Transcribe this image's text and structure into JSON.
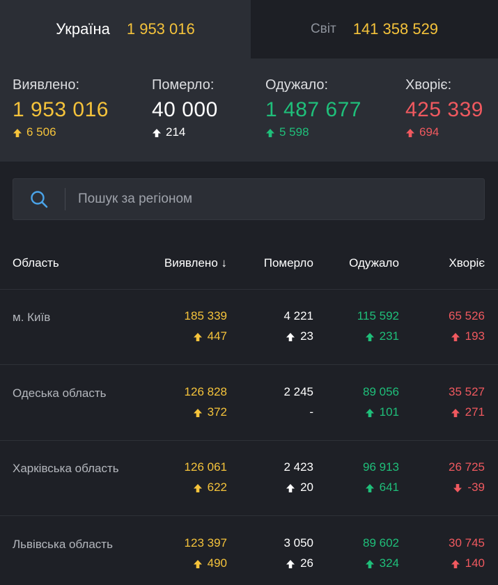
{
  "tabs": {
    "ukraine": {
      "label": "Україна",
      "value": "1 953 016"
    },
    "world": {
      "label": "Світ",
      "value": "141 358 529"
    }
  },
  "summary": {
    "detected": {
      "label": "Виявлено:",
      "value": "1 953 016",
      "delta": "6 506"
    },
    "died": {
      "label": "Померло:",
      "value": "40 000",
      "delta": "214"
    },
    "recovered": {
      "label": "Одужало:",
      "value": "1 487 677",
      "delta": "5 598"
    },
    "sick": {
      "label": "Хворіє:",
      "value": "425 339",
      "delta": "694"
    }
  },
  "search": {
    "placeholder": "Пошук за регіоном"
  },
  "table": {
    "headers": {
      "region": "Область",
      "detected": "Виявлено ↓",
      "died": "Померло",
      "recovered": "Одужало",
      "sick": "Хворіє"
    },
    "rows": [
      {
        "region": "м. Київ",
        "detected": "185 339",
        "detected_delta": "447",
        "died": "4 221",
        "died_delta": "23",
        "recovered": "115 592",
        "recovered_delta": "231",
        "sick": "65 526",
        "sick_delta": "193"
      },
      {
        "region": "Одеська область",
        "detected": "126 828",
        "detected_delta": "372",
        "died": "2 245",
        "died_delta": "-",
        "recovered": "89 056",
        "recovered_delta": "101",
        "sick": "35 527",
        "sick_delta": "271"
      },
      {
        "region": "Харківська область",
        "detected": "126 061",
        "detected_delta": "622",
        "died": "2 423",
        "died_delta": "20",
        "recovered": "96 913",
        "recovered_delta": "641",
        "sick": "26 725",
        "sick_delta": "-39"
      },
      {
        "region": "Львівська область",
        "detected": "123 397",
        "detected_delta": "490",
        "died": "3 050",
        "died_delta": "26",
        "recovered": "89 602",
        "recovered_delta": "324",
        "sick": "30 745",
        "sick_delta": "140"
      }
    ]
  },
  "colors": {
    "yellow": "#f5c33b",
    "white": "#ffffff",
    "green": "#1fbf7a",
    "red": "#f0595f",
    "accent_blue": "#4aa3e8"
  },
  "icons": {
    "search": "search-icon",
    "up": "arrow-up-icon",
    "down": "arrow-down-icon"
  }
}
